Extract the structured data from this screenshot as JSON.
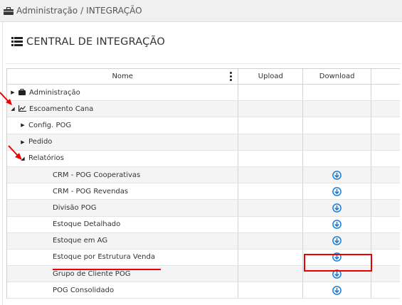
{
  "breadcrumb": {
    "icon": "briefcase-icon",
    "root": "Administração",
    "separator": "/",
    "current": "INTEGRAÇÃO"
  },
  "page": {
    "title_icon": "list-icon",
    "title": "CENTRAL DE INTEGRAÇÃO"
  },
  "grid": {
    "columns": {
      "name": "Nome",
      "upload": "Upload",
      "download": "Download"
    },
    "rows": [
      {
        "label": "Administração",
        "level": 0,
        "expanded": false,
        "icon": "briefcase-icon",
        "download": false
      },
      {
        "label": "Escoamento Cana",
        "level": 0,
        "expanded": true,
        "icon": "line-chart-icon",
        "download": false
      },
      {
        "label": "Config. POG",
        "level": 1,
        "expanded": false,
        "download": false
      },
      {
        "label": "Pedido",
        "level": 1,
        "expanded": false,
        "download": false
      },
      {
        "label": "Relatórios",
        "level": 1,
        "expanded": true,
        "download": false
      },
      {
        "label": "CRM - POG Cooperativas",
        "level": 2,
        "download": true
      },
      {
        "label": "CRM - POG Revendas",
        "level": 2,
        "download": true
      },
      {
        "label": "Divisão POG",
        "level": 2,
        "download": true
      },
      {
        "label": "Estoque Detalhado",
        "level": 2,
        "download": true
      },
      {
        "label": "Estoque em AG",
        "level": 2,
        "download": true
      },
      {
        "label": "Estoque por Estrutura Venda",
        "level": 2,
        "download": true
      },
      {
        "label": "Grupo de Cliente POG",
        "level": 2,
        "download": true
      },
      {
        "label": "POG Consolidado",
        "level": 2,
        "download": true
      }
    ]
  },
  "colors": {
    "annotation_red": "#e00000",
    "download_blue": "#1e7fd8"
  }
}
